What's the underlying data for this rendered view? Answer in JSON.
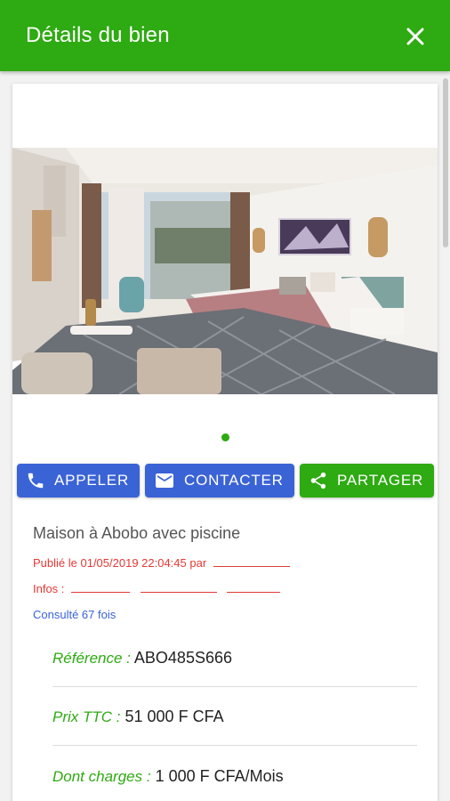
{
  "appbar": {
    "title": "Détails du bien",
    "close_icon": "close-icon"
  },
  "carousel": {
    "image_alt": "bedroom-photo",
    "page_indicator": 1,
    "page_count": 1
  },
  "actions": {
    "call_label": "APPELER",
    "contact_label": "CONTACTER",
    "share_label": "PARTAGER"
  },
  "property": {
    "title": "Maison à Abobo avec piscine",
    "published": "Publié le 01/05/2019 22:04:45 par",
    "infos_label": "Infos :",
    "views": "Consulté 67 fois"
  },
  "details": [
    {
      "label": "Référence :",
      "value": "ABO485S666"
    },
    {
      "label": "Prix TTC :",
      "value": "51 000 F CFA"
    },
    {
      "label": "Dont charges :",
      "value": "1 000 F CFA/Mois"
    }
  ],
  "colors": {
    "primary": "#2eaa12",
    "accent": "#3a63d6",
    "danger": "#e53935"
  }
}
